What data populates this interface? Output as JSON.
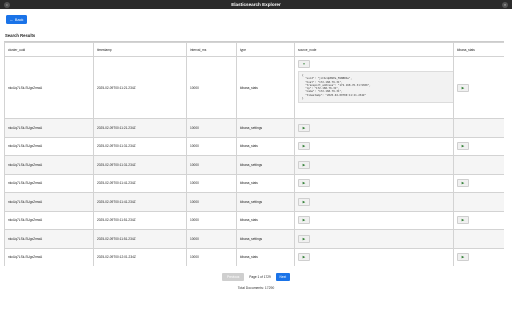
{
  "window": {
    "title": "Elasticsearch Explorer"
  },
  "toolbar": {
    "back_label": "Back"
  },
  "section": {
    "title": "Search Results"
  },
  "table": {
    "columns": [
      "cluster_uuid",
      "timestamp",
      "interval_ms",
      "type",
      "source_node",
      "kibana_stats"
    ],
    "rows": [
      {
        "cluster_uuid": "nkcUq7LSk-SUgxZmwA",
        "timestamp": "2025-02-09T00:11:21.234Z",
        "interval_ms": "10000",
        "type": "kibana_stats",
        "source_node_expanded": true,
        "kibana_toggle": true
      },
      {
        "cluster_uuid": "nkcUq7LSk-SUgxZmwA",
        "timestamp": "2025-02-09T00:11:21.234Z",
        "interval_ms": "10000",
        "type": "kibana_settings",
        "source_node_expanded": false,
        "kibana_toggle": false
      },
      {
        "cluster_uuid": "nkcUq7LSk-SUgxZmwA",
        "timestamp": "2025-02-09T00:11:31.234Z",
        "interval_ms": "10000",
        "type": "kibana_stats",
        "source_node_expanded": false,
        "kibana_toggle": true
      },
      {
        "cluster_uuid": "nkcUq7LSk-SUgxZmwA",
        "timestamp": "2025-02-09T00:11:31.234Z",
        "interval_ms": "10000",
        "type": "kibana_settings",
        "source_node_expanded": false,
        "kibana_toggle": false
      },
      {
        "cluster_uuid": "nkcUq7LSk-SUgxZmwA",
        "timestamp": "2025-02-09T00:11:41.234Z",
        "interval_ms": "10000",
        "type": "kibana_stats",
        "source_node_expanded": false,
        "kibana_toggle": true
      },
      {
        "cluster_uuid": "nkcUq7LSk-SUgxZmwA",
        "timestamp": "2025-02-09T00:11:41.234Z",
        "interval_ms": "10000",
        "type": "kibana_settings",
        "source_node_expanded": false,
        "kibana_toggle": false
      },
      {
        "cluster_uuid": "nkcUq7LSk-SUgxZmwA",
        "timestamp": "2025-02-09T00:11:51.234Z",
        "interval_ms": "10000",
        "type": "kibana_stats",
        "source_node_expanded": false,
        "kibana_toggle": true
      },
      {
        "cluster_uuid": "nkcUq7LSk-SUgxZmwA",
        "timestamp": "2025-02-09T00:11:51.234Z",
        "interval_ms": "10000",
        "type": "kibana_settings",
        "source_node_expanded": false,
        "kibana_toggle": false
      },
      {
        "cluster_uuid": "nkcUq7LSk-SUgxZmwA",
        "timestamp": "2025-02-09T00:12:01.234Z",
        "interval_ms": "10000",
        "type": "kibana_stats",
        "source_node_expanded": false,
        "kibana_toggle": true
      },
      {
        "cluster_uuid": "nkcUq7LSk-SUgxZmwA",
        "timestamp": "2025-02-09T00:12:01.234Z",
        "interval_ms": "10000",
        "type": "kibana_settings",
        "source_node_expanded": false,
        "kibana_toggle": false
      }
    ],
    "source_node_json": "{\n  \"uuid\": \"jcCbcqbBSEe_M1NBRSe\",\n  \"host\": \"172.168.76.31\",\n  \"transport_address\": \"172.168.76.31:9300\",\n  \"ip\": \"172.168.76.31\",\n  \"name\": \"172.168.76.31\",\n  \"timestamp\": \"2025-02-09T00:11:21.234Z\"\n}",
    "collapse_glyph": "▾",
    "expand_glyph": "▶"
  },
  "pagination": {
    "prev_label": "Previous",
    "page_text": "Page 1 of 1729",
    "next_label": "Next"
  },
  "footer": {
    "total_text": "Total Documents: 17290"
  },
  "colors": {
    "accent": "#1a73e8",
    "expand_icon": "#2e7d32"
  }
}
